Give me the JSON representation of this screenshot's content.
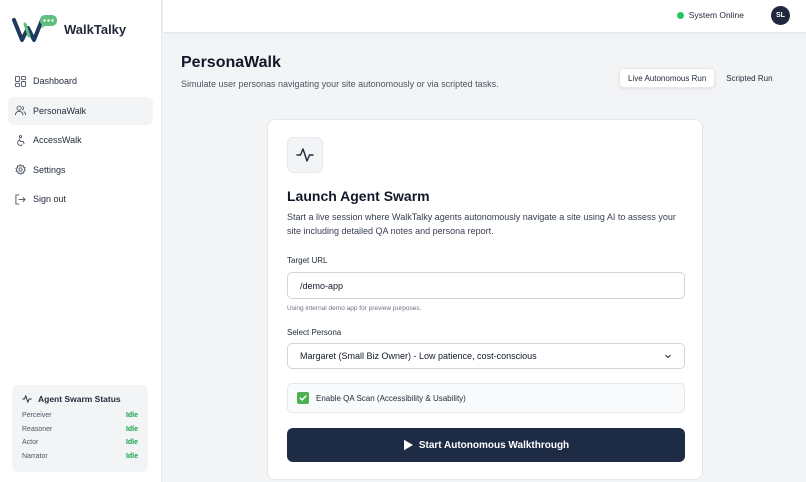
{
  "app": {
    "name": "WalkTalky"
  },
  "sidebar": {
    "items": [
      {
        "label": "Dashboard",
        "icon": "dashboard-icon"
      },
      {
        "label": "PersonaWalk",
        "icon": "users-icon",
        "active": true
      },
      {
        "label": "AccessWalk",
        "icon": "accessibility-icon"
      },
      {
        "label": "Settings",
        "icon": "gear-icon"
      },
      {
        "label": "Sign out",
        "icon": "sign-out-icon"
      }
    ],
    "swarm_status": {
      "title": "Agent Swarm Status",
      "agents": [
        {
          "name": "Perceiver",
          "status": "Idle"
        },
        {
          "name": "Reasoner",
          "status": "Idle"
        },
        {
          "name": "Actor",
          "status": "Idle"
        },
        {
          "name": "Narrator",
          "status": "Idle"
        }
      ]
    }
  },
  "header": {
    "system_status": "System Online",
    "avatar_initials": "SL"
  },
  "page": {
    "title": "PersonaWalk",
    "subtitle": "Simulate user personas navigating your site autonomously or via scripted tasks.",
    "tabs": [
      {
        "label": "Live Autonomous Run",
        "active": true
      },
      {
        "label": "Scripted Run",
        "active": false
      }
    ]
  },
  "card": {
    "title": "Launch Agent Swarm",
    "description": "Start a live session where WalkTalky agents autonomously navigate a site using AI to assess your site including detailed QA notes and persona report.",
    "target_url_label": "Target URL",
    "target_url_value": "/demo-app",
    "target_url_hint": "Using internal demo app for preview purposes.",
    "persona_label": "Select Persona",
    "persona_selected": "Margaret (Small Biz Owner) - Low patience, cost-conscious",
    "qa_scan_label": "Enable QA Scan (Accessibility & Usability)",
    "qa_scan_checked": true,
    "start_button": "Start Autonomous Walkthrough"
  },
  "colors": {
    "accent_navy": "#1e2b45",
    "status_green": "#22c55e",
    "check_green": "#4caf50",
    "logo_green": "#5fbf7f"
  }
}
